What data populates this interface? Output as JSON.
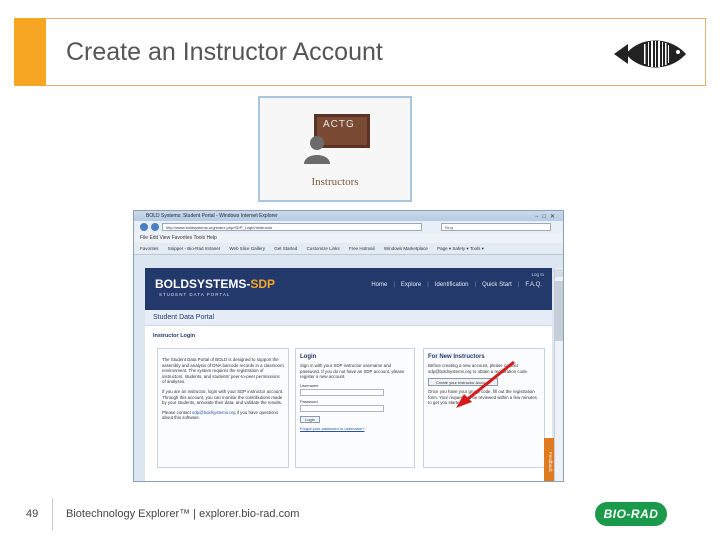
{
  "slide": {
    "title": "Create an Instructor Account",
    "page_number": "49",
    "footer": "Biotechnology Explorer™ |  explorer.bio-rad.com",
    "brand": "BIO-RAD",
    "colors": {
      "accent": "#f6a623",
      "header_border": "#e8b16a",
      "brand_green": "#1b9a4c",
      "portal_navy": "#23386b"
    }
  },
  "instructors_card": {
    "board_text": "ACTG",
    "label": "Instructors"
  },
  "browser": {
    "title": "BOLD Systems: Student Portal - Windows Internet Explorer",
    "url": "http://www.boldsystems.org/index.php/SDP_Login/Instructor",
    "search_placeholder": "Bing",
    "menu": "File  Edit  View  Favorites  Tools  Help",
    "favorites": [
      "Favorites",
      "Snipper - Bio-Rad Intranet",
      "Web Slice Gallery",
      "Get Started",
      "Customize Links",
      "Free Hotmail",
      "Windows Marketplace"
    ],
    "toolbar_right": "Page ▾  Safety ▾  Tools ▾"
  },
  "site": {
    "logo_main": "BOLDSYSTEMS-",
    "logo_sdp": "SDP",
    "subtitle": "STUDENT DATA PORTAL",
    "login_link": "Log In",
    "nav": [
      "Home",
      "Explore",
      "Identification",
      "Quick Start",
      "F.A.Q."
    ],
    "portal_heading": "Student Data Portal",
    "section_heading": "Instructor Login",
    "intro_p1": "The Student Data Portal of BOLD is designed to support the assembly and analysis of DNA barcode records in a classroom environment. The system requires the registration of instructors, students, and students' peer-to-peer permissions of analyses.",
    "intro_p2": "If you are an instructor, login with your SDP instructor account. Through this account, you can monitor the contributions made by your students, annotate their data, and validate the results.",
    "intro_p3_prefix": "Please contact ",
    "intro_email": "sdp@boldsystems.org",
    "intro_p3_suffix": " if you have questions about this software.",
    "login_heading": "Login",
    "login_text": "Sign in with your SDP instructor username and password. If you do not have an SDP account, please register a new account.",
    "username_label": "Username",
    "password_label": "Password",
    "login_button": "Login",
    "forgot_link": "Forgot your password or username?",
    "new_heading": "For New Instructors",
    "new_text": "Before creating a new account, please contact sdp@boldsystems.org to obtain a registration code.",
    "create_button": "Create your Instructor Account",
    "after_text": "Once you have your group code, fill out the registration form. Your request will be reviewed within a few minutes to get you started.",
    "feedback_tab": "Feedback"
  }
}
